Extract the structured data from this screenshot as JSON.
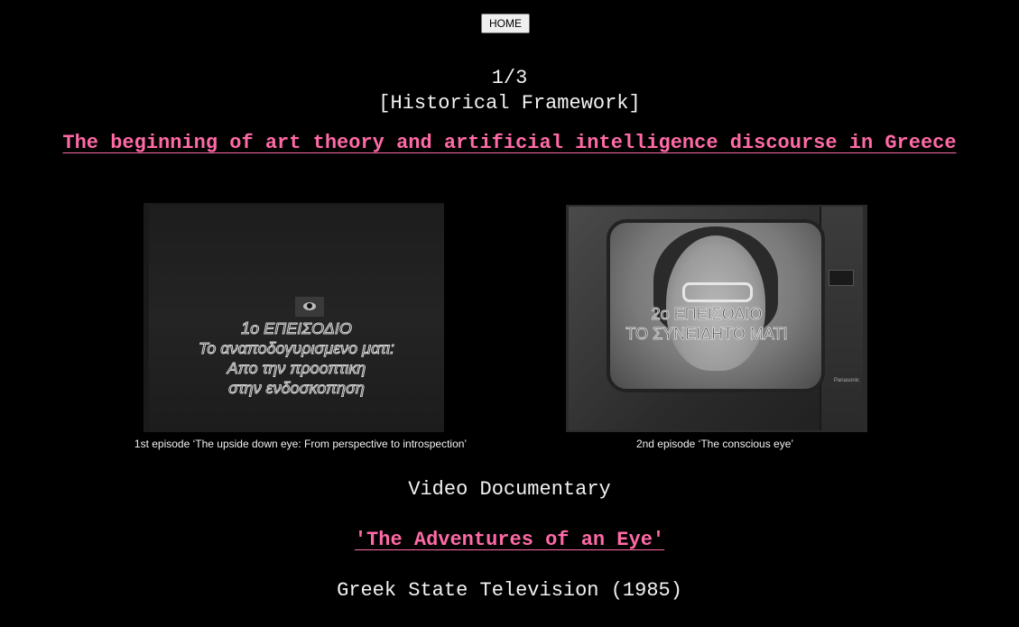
{
  "nav": {
    "home_label": "HOME"
  },
  "header": {
    "counter": "1/3",
    "section": "[Historical Framework]",
    "title": "The beginning of art theory and artificial intelligence discourse in Greece"
  },
  "stills": [
    {
      "overlay_lines": [
        "1ο ΕΠΕΙΣΟΔΙΟ",
        "Το αναποδογυρισμενο ματι:",
        "Απο την προοπτικη",
        "στην ενδοσκοπηση"
      ],
      "caption": "1st episode ‘The upside down eye: From perspective to introspection’"
    },
    {
      "overlay_lines": [
        "2ο ΕΠΕΙΣΟΔΙΟ",
        "ΤΟ ΣΥΝΕΙΔΗΤΟ ΜΑΤΙ"
      ],
      "caption": "2nd episode ‘The conscious eye’",
      "tv_brand": "Panasonic"
    }
  ],
  "documentary": {
    "label": "Video Documentary",
    "title": "'The Adventures of an Eye'",
    "source": "Greek State Television (1985)"
  },
  "colors": {
    "background": "#000000",
    "text": "#f2f2f2",
    "link": "#ff6aa6"
  },
  "icons": {
    "eye": "eye-icon"
  }
}
